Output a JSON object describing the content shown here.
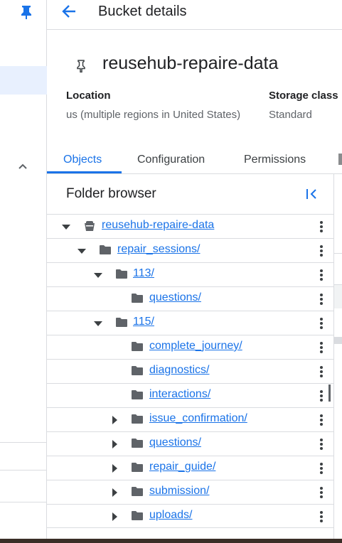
{
  "header": {
    "title": "Bucket details"
  },
  "bucket": {
    "name": "reusehub-repaire-data"
  },
  "meta": {
    "location_label": "Location",
    "location_value": "us (multiple regions in United States)",
    "storage_label": "Storage class",
    "storage_value": "Standard"
  },
  "tabs": [
    {
      "label": "Objects",
      "active": true
    },
    {
      "label": "Configuration",
      "active": false
    },
    {
      "label": "Permissions",
      "active": false
    }
  ],
  "folder_browser": {
    "title": "Folder browser",
    "rows": [
      {
        "label": "reusehub-repaire-data",
        "expanded": true,
        "kind": "bucket"
      },
      {
        "label": "repair_sessions/",
        "expanded": true,
        "kind": "folder"
      },
      {
        "label": "113/",
        "expanded": true,
        "kind": "folder"
      },
      {
        "label": "questions/",
        "kind": "folder"
      },
      {
        "label": "115/",
        "expanded": true,
        "kind": "folder"
      },
      {
        "label": "complete_journey/",
        "kind": "folder"
      },
      {
        "label": "diagnostics/",
        "kind": "folder"
      },
      {
        "label": "interactions/",
        "kind": "folder"
      },
      {
        "label": "issue_confirmation/",
        "expanded": false,
        "kind": "folder"
      },
      {
        "label": "questions/",
        "expanded": false,
        "kind": "folder"
      },
      {
        "label": "repair_guide/",
        "expanded": false,
        "kind": "folder"
      },
      {
        "label": "submission/",
        "expanded": false,
        "kind": "folder"
      },
      {
        "label": "uploads/",
        "expanded": false,
        "kind": "folder"
      }
    ]
  },
  "colors": {
    "accent": "#1a73e8",
    "icon": "#5f6368",
    "active_nav_bg": "#e8f0fe"
  }
}
